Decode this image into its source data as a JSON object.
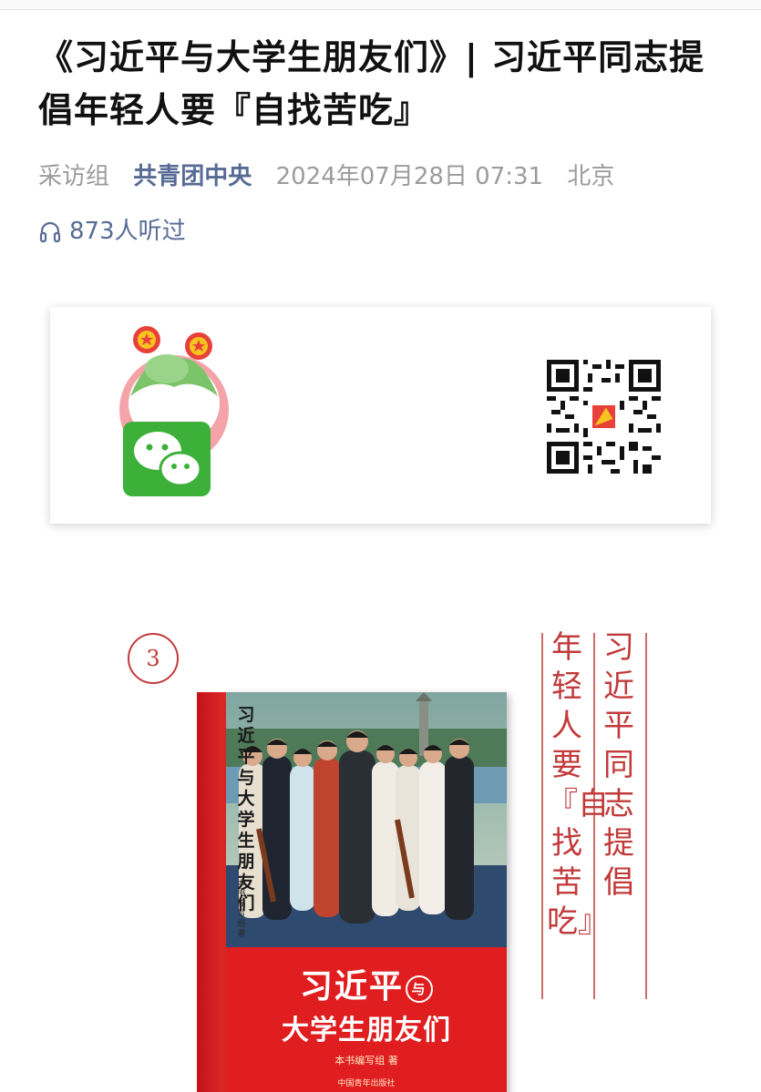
{
  "article": {
    "title": "《习近平与大学生朋友们》| 习近平同志提倡年轻人要『自找苦吃』",
    "meta": {
      "author": "采访组",
      "account": "共青团中央",
      "datetime": "2024年07月28日 07:31",
      "location": "北京"
    },
    "listen": {
      "icon": "headphones-icon",
      "count_text": "873人听过"
    }
  },
  "card": {
    "mascot_icon": "wechat-mascot-icon",
    "qr_icon": "qr-code-icon"
  },
  "poster": {
    "number": "3",
    "vertical_right": "习近平同志提倡",
    "vertical_left": "年轻人要『自找苦吃』",
    "book": {
      "vertical_title": "习近平与大学生朋友们",
      "vertical_author": "本书编写组著",
      "cover_title_line1": "习近平",
      "cover_title_badge": "与",
      "cover_title_line2": "大学生朋友们",
      "author": "本书编写组 著",
      "publisher": "中国青年出版社"
    }
  },
  "colors": {
    "link_blue": "#576b95",
    "meta_gray": "#9b9b9b",
    "poster_red": "#c23a3a",
    "book_red": "#e01d1f",
    "wechat_green": "#3db03a"
  }
}
